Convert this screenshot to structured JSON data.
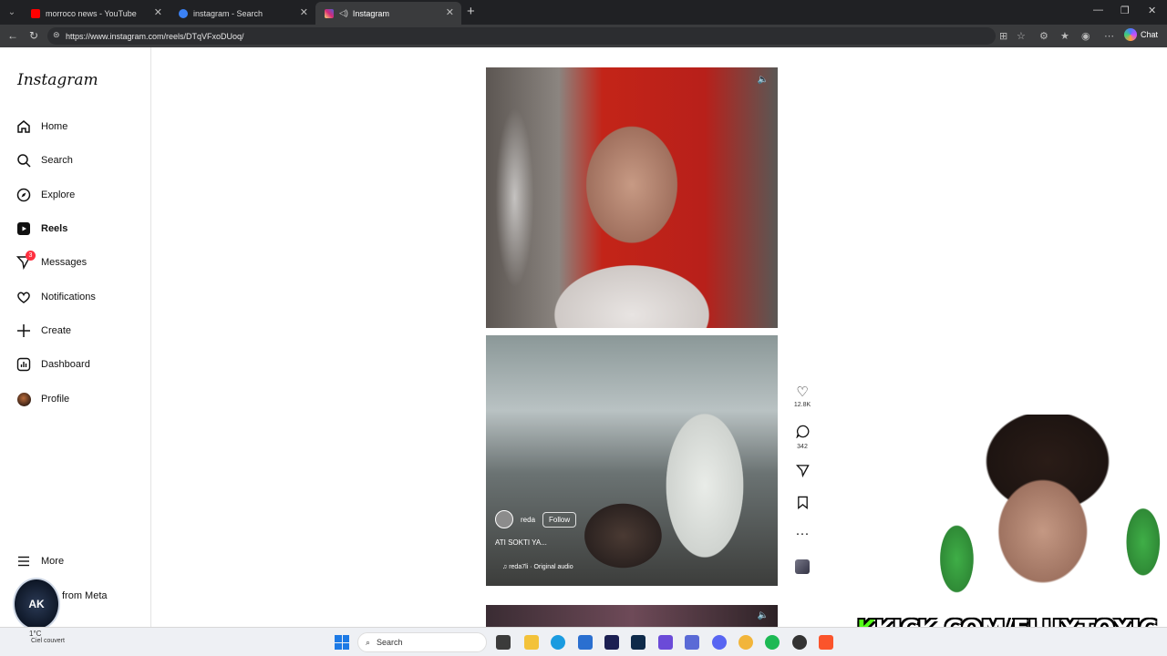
{
  "browser": {
    "tabs": [
      {
        "label": "morroco news - YouTube",
        "favicon_color": "#ff0000"
      },
      {
        "label": "instagram - Search",
        "favicon_color": "#3b82f6"
      },
      {
        "label": "Instagram",
        "favicon_color": "#d62976"
      }
    ],
    "url": "https://www.instagram.com/reels/DTqVFxoDUoq/",
    "chat_label": "Chat"
  },
  "sidebar": {
    "logo": "Instagram",
    "items": [
      {
        "label": "Home",
        "icon": "home-icon"
      },
      {
        "label": "Search",
        "icon": "search-icon"
      },
      {
        "label": "Explore",
        "icon": "compass-icon"
      },
      {
        "label": "Reels",
        "icon": "reels-icon"
      },
      {
        "label": "Messages",
        "icon": "messages-icon",
        "badge": "3"
      },
      {
        "label": "Notifications",
        "icon": "heart-icon"
      },
      {
        "label": "Create",
        "icon": "plus-icon"
      },
      {
        "label": "Dashboard",
        "icon": "dashboard-icon"
      },
      {
        "label": "Profile",
        "icon": "avatar"
      }
    ],
    "more_label": "More",
    "also_from_meta": "from Meta"
  },
  "reel": {
    "username": "reda",
    "follow_label": "Follow",
    "caption": "ATI SOKTI YA...",
    "audio": "reda7li · Original audio",
    "likes": "12.8K",
    "comments": "342"
  },
  "overlay": {
    "kick_prefix": "K",
    "kick_text": "KICK.COM/FLUXTOXIC",
    "ak_logo": "AK"
  },
  "taskbar": {
    "weather_temp": "1°C",
    "weather_desc": "Ciel couvert",
    "search_placeholder": "Search"
  }
}
